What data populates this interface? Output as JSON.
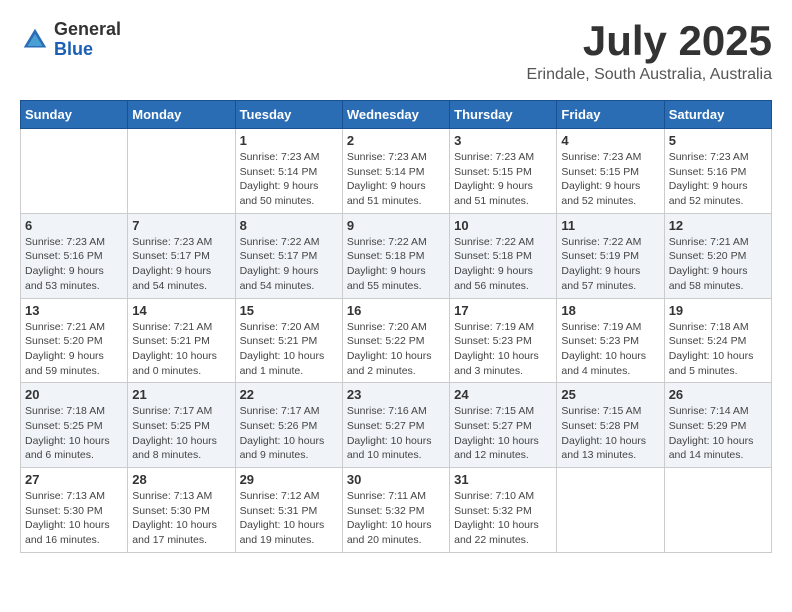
{
  "header": {
    "logo_line1": "General",
    "logo_line2": "Blue",
    "month_title": "July 2025",
    "location": "Erindale, South Australia, Australia"
  },
  "calendar": {
    "headers": [
      "Sunday",
      "Monday",
      "Tuesday",
      "Wednesday",
      "Thursday",
      "Friday",
      "Saturday"
    ],
    "weeks": [
      [
        {
          "day": "",
          "info": ""
        },
        {
          "day": "",
          "info": ""
        },
        {
          "day": "1",
          "info": "Sunrise: 7:23 AM\nSunset: 5:14 PM\nDaylight: 9 hours\nand 50 minutes."
        },
        {
          "day": "2",
          "info": "Sunrise: 7:23 AM\nSunset: 5:14 PM\nDaylight: 9 hours\nand 51 minutes."
        },
        {
          "day": "3",
          "info": "Sunrise: 7:23 AM\nSunset: 5:15 PM\nDaylight: 9 hours\nand 51 minutes."
        },
        {
          "day": "4",
          "info": "Sunrise: 7:23 AM\nSunset: 5:15 PM\nDaylight: 9 hours\nand 52 minutes."
        },
        {
          "day": "5",
          "info": "Sunrise: 7:23 AM\nSunset: 5:16 PM\nDaylight: 9 hours\nand 52 minutes."
        }
      ],
      [
        {
          "day": "6",
          "info": "Sunrise: 7:23 AM\nSunset: 5:16 PM\nDaylight: 9 hours\nand 53 minutes."
        },
        {
          "day": "7",
          "info": "Sunrise: 7:23 AM\nSunset: 5:17 PM\nDaylight: 9 hours\nand 54 minutes."
        },
        {
          "day": "8",
          "info": "Sunrise: 7:22 AM\nSunset: 5:17 PM\nDaylight: 9 hours\nand 54 minutes."
        },
        {
          "day": "9",
          "info": "Sunrise: 7:22 AM\nSunset: 5:18 PM\nDaylight: 9 hours\nand 55 minutes."
        },
        {
          "day": "10",
          "info": "Sunrise: 7:22 AM\nSunset: 5:18 PM\nDaylight: 9 hours\nand 56 minutes."
        },
        {
          "day": "11",
          "info": "Sunrise: 7:22 AM\nSunset: 5:19 PM\nDaylight: 9 hours\nand 57 minutes."
        },
        {
          "day": "12",
          "info": "Sunrise: 7:21 AM\nSunset: 5:20 PM\nDaylight: 9 hours\nand 58 minutes."
        }
      ],
      [
        {
          "day": "13",
          "info": "Sunrise: 7:21 AM\nSunset: 5:20 PM\nDaylight: 9 hours\nand 59 minutes."
        },
        {
          "day": "14",
          "info": "Sunrise: 7:21 AM\nSunset: 5:21 PM\nDaylight: 10 hours\nand 0 minutes."
        },
        {
          "day": "15",
          "info": "Sunrise: 7:20 AM\nSunset: 5:21 PM\nDaylight: 10 hours\nand 1 minute."
        },
        {
          "day": "16",
          "info": "Sunrise: 7:20 AM\nSunset: 5:22 PM\nDaylight: 10 hours\nand 2 minutes."
        },
        {
          "day": "17",
          "info": "Sunrise: 7:19 AM\nSunset: 5:23 PM\nDaylight: 10 hours\nand 3 minutes."
        },
        {
          "day": "18",
          "info": "Sunrise: 7:19 AM\nSunset: 5:23 PM\nDaylight: 10 hours\nand 4 minutes."
        },
        {
          "day": "19",
          "info": "Sunrise: 7:18 AM\nSunset: 5:24 PM\nDaylight: 10 hours\nand 5 minutes."
        }
      ],
      [
        {
          "day": "20",
          "info": "Sunrise: 7:18 AM\nSunset: 5:25 PM\nDaylight: 10 hours\nand 6 minutes."
        },
        {
          "day": "21",
          "info": "Sunrise: 7:17 AM\nSunset: 5:25 PM\nDaylight: 10 hours\nand 8 minutes."
        },
        {
          "day": "22",
          "info": "Sunrise: 7:17 AM\nSunset: 5:26 PM\nDaylight: 10 hours\nand 9 minutes."
        },
        {
          "day": "23",
          "info": "Sunrise: 7:16 AM\nSunset: 5:27 PM\nDaylight: 10 hours\nand 10 minutes."
        },
        {
          "day": "24",
          "info": "Sunrise: 7:15 AM\nSunset: 5:27 PM\nDaylight: 10 hours\nand 12 minutes."
        },
        {
          "day": "25",
          "info": "Sunrise: 7:15 AM\nSunset: 5:28 PM\nDaylight: 10 hours\nand 13 minutes."
        },
        {
          "day": "26",
          "info": "Sunrise: 7:14 AM\nSunset: 5:29 PM\nDaylight: 10 hours\nand 14 minutes."
        }
      ],
      [
        {
          "day": "27",
          "info": "Sunrise: 7:13 AM\nSunset: 5:30 PM\nDaylight: 10 hours\nand 16 minutes."
        },
        {
          "day": "28",
          "info": "Sunrise: 7:13 AM\nSunset: 5:30 PM\nDaylight: 10 hours\nand 17 minutes."
        },
        {
          "day": "29",
          "info": "Sunrise: 7:12 AM\nSunset: 5:31 PM\nDaylight: 10 hours\nand 19 minutes."
        },
        {
          "day": "30",
          "info": "Sunrise: 7:11 AM\nSunset: 5:32 PM\nDaylight: 10 hours\nand 20 minutes."
        },
        {
          "day": "31",
          "info": "Sunrise: 7:10 AM\nSunset: 5:32 PM\nDaylight: 10 hours\nand 22 minutes."
        },
        {
          "day": "",
          "info": ""
        },
        {
          "day": "",
          "info": ""
        }
      ]
    ]
  }
}
